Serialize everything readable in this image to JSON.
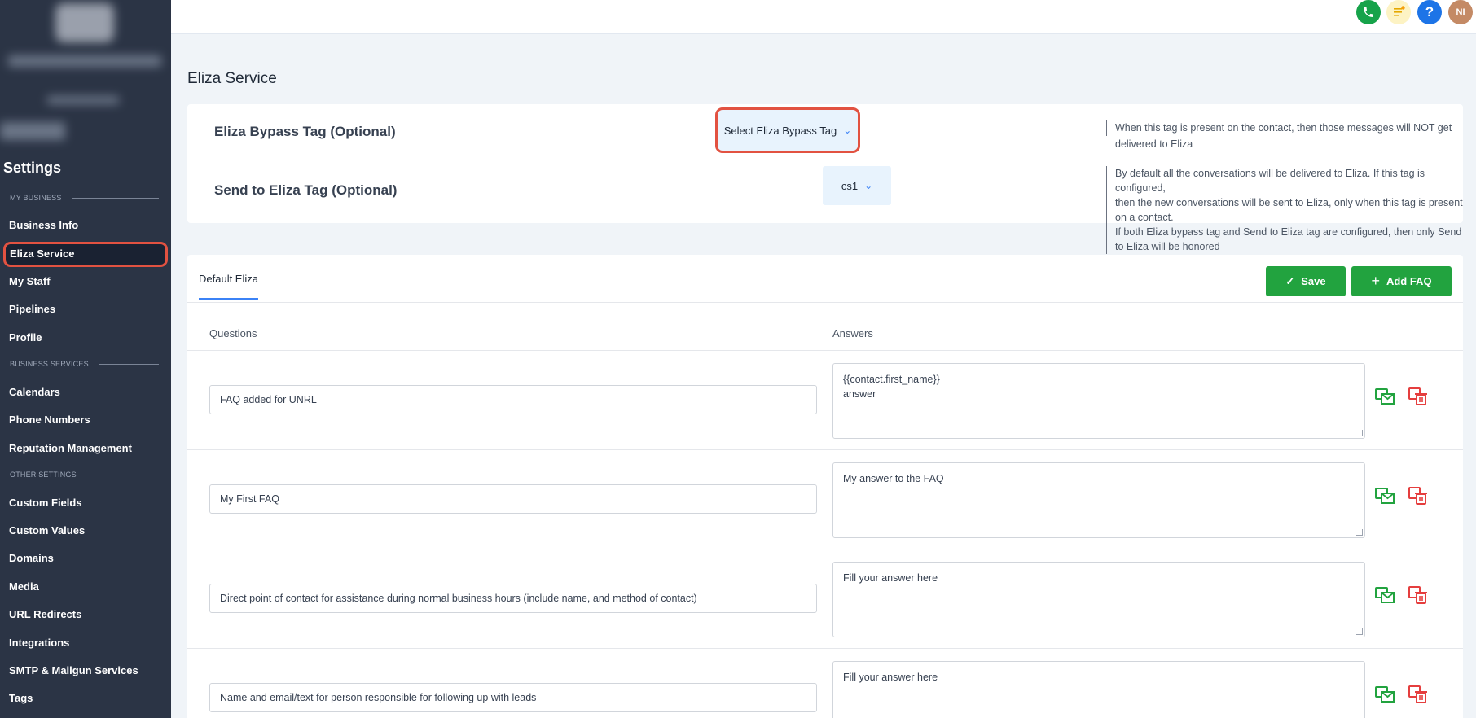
{
  "sidebar": {
    "title": "Settings",
    "sections": [
      {
        "label": "MY BUSINESS"
      },
      {
        "label": "BUSINESS SERVICES"
      },
      {
        "label": "OTHER SETTINGS"
      }
    ],
    "items": [
      {
        "label": "Business Info"
      },
      {
        "label": "Eliza Service"
      },
      {
        "label": "My Staff"
      },
      {
        "label": "Pipelines"
      },
      {
        "label": "Profile"
      },
      {
        "label": "Calendars"
      },
      {
        "label": "Phone Numbers"
      },
      {
        "label": "Reputation Management"
      },
      {
        "label": "Custom Fields"
      },
      {
        "label": "Custom Values"
      },
      {
        "label": "Domains"
      },
      {
        "label": "Media"
      },
      {
        "label": "URL Redirects"
      },
      {
        "label": "Integrations"
      },
      {
        "label": "SMTP & Mailgun Services"
      },
      {
        "label": "Tags"
      }
    ]
  },
  "header": {
    "icons": [
      "phone-icon",
      "notes-icon",
      "help-icon",
      "avatar"
    ],
    "help_glyph": "?",
    "avatar_initials": "NI",
    "colors": {
      "phone": "#16a34a",
      "notes": "#fdf3c4",
      "help": "#1d74e7",
      "avatar": "#c48a65"
    }
  },
  "page": {
    "title": "Eliza Service"
  },
  "tags": {
    "bypass_label": "Eliza Bypass Tag (Optional)",
    "bypass_select": "Select Eliza Bypass Tag",
    "bypass_note": "When this tag is present on the contact, then those messages will NOT get delivered to Eliza",
    "send_label": "Send to Eliza Tag (Optional)",
    "send_select": "cs1",
    "send_note": [
      "By default all the conversations will be delivered to Eliza. If this tag is configured,",
      "then the new conversations will be sent to Eliza, only when this tag is present on a contact.",
      "If both Eliza bypass tag and Send to Eliza tag are configured, then only Send to Eliza will be honored"
    ]
  },
  "faq": {
    "tab": "Default Eliza",
    "save_label": "Save",
    "add_label": "Add FAQ",
    "col_questions": "Questions",
    "col_answers": "Answers",
    "rows": [
      {
        "question": "FAQ added for UNRL",
        "answer": "{{contact.first_name}}\nanswer"
      },
      {
        "question": "My First FAQ",
        "answer": "My answer to the FAQ"
      },
      {
        "question": "Direct point of contact for assistance during normal business hours (include name, and method of contact)",
        "answer": "Fill your answer here"
      },
      {
        "question": "Name and email/text for person responsible for following up with leads",
        "answer": "Fill your answer here"
      }
    ]
  },
  "colors": {
    "accent": "#3b82f6",
    "button_green": "#22a33f",
    "highlight": "#e25241",
    "sidebar_bg": "#2b3445"
  }
}
